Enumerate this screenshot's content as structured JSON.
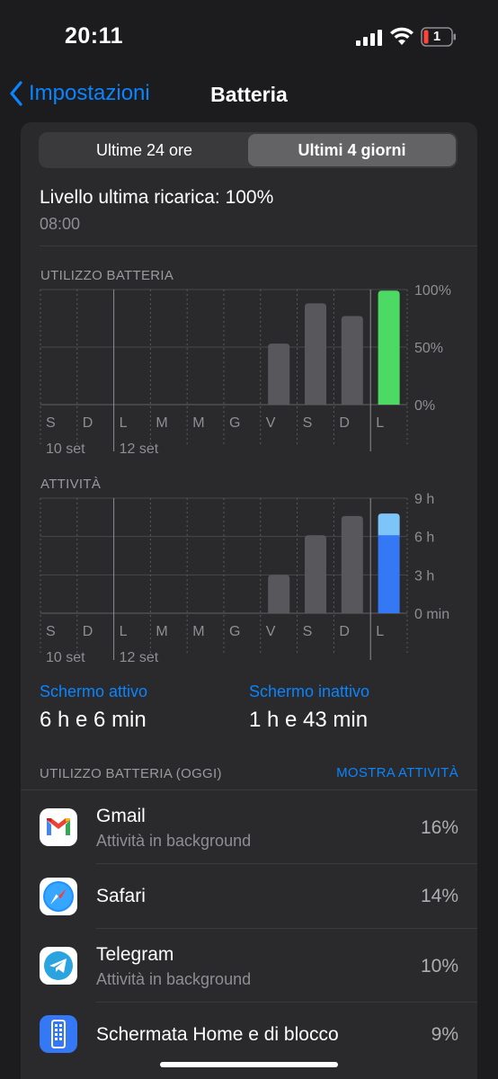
{
  "status": {
    "time": "20:11",
    "battery_level": "1"
  },
  "nav": {
    "back_label": "Impostazioni",
    "title": "Batteria"
  },
  "segments": [
    "Ultime 24 ore",
    "Ultimi 4 giorni"
  ],
  "selected_segment": "Ultimi 4 giorni",
  "last_charge": {
    "label": "Livello ultima ricarica: 100%",
    "time": "08:00"
  },
  "battery_usage_label": "UTILIZZO BATTERIA",
  "activity_label": "ATTIVITÀ",
  "stats": {
    "screen_on_label": "Schermo attivo",
    "screen_on_value": "6 h e 6 min",
    "screen_off_label": "Schermo inattivo",
    "screen_off_value": "1 h e 43 min"
  },
  "usage_today_label": "UTILIZZO BATTERIA (OGGI)",
  "show_activity_label": "MOSTRA ATTIVITÀ",
  "apps": [
    {
      "name": "Gmail",
      "subtitle": "Attività in background",
      "percent": "16%",
      "icon": "gmail-icon"
    },
    {
      "name": "Safari",
      "subtitle": "",
      "percent": "14%",
      "icon": "safari-icon"
    },
    {
      "name": "Telegram",
      "subtitle": "Attività in background",
      "percent": "10%",
      "icon": "telegram-icon"
    },
    {
      "name": "Schermata Home e di blocco",
      "subtitle": "",
      "percent": "9%",
      "icon": "home-lock-screen-icon"
    }
  ],
  "colors": {
    "accent": "#0a84ff",
    "battery_full": "#4cd964",
    "bar_gray": "#58585c",
    "screen_on": "#3478f6",
    "screen_off": "#7dc4f8"
  },
  "chart_data": [
    {
      "type": "bar",
      "title": "UTILIZZO BATTERIA",
      "categories": [
        "S",
        "D",
        "L",
        "M",
        "M",
        "G",
        "V",
        "S",
        "D",
        "L"
      ],
      "date_labels": [
        "10 set",
        "12 set"
      ],
      "values": [
        null,
        null,
        null,
        null,
        null,
        null,
        53,
        88,
        77,
        99
      ],
      "highlight_index": 9,
      "ylim": [
        0,
        100
      ],
      "y_ticks": [
        "100%",
        "50%",
        "0%"
      ]
    },
    {
      "type": "bar",
      "title": "ATTIVITÀ",
      "categories": [
        "S",
        "D",
        "L",
        "M",
        "M",
        "G",
        "V",
        "S",
        "D",
        "L"
      ],
      "date_labels": [
        "10 set",
        "12 set"
      ],
      "values": [
        null,
        null,
        null,
        null,
        null,
        null,
        3.0,
        6.1,
        7.6,
        7.8
      ],
      "highlight_index": 9,
      "highlight_series": [
        {
          "name": "Schermo attivo",
          "value": 6.1
        },
        {
          "name": "Schermo inattivo",
          "value": 1.7
        }
      ],
      "ylim": [
        0,
        9
      ],
      "y_ticks": [
        "9 h",
        "6 h",
        "3 h",
        "0 min"
      ]
    }
  ]
}
